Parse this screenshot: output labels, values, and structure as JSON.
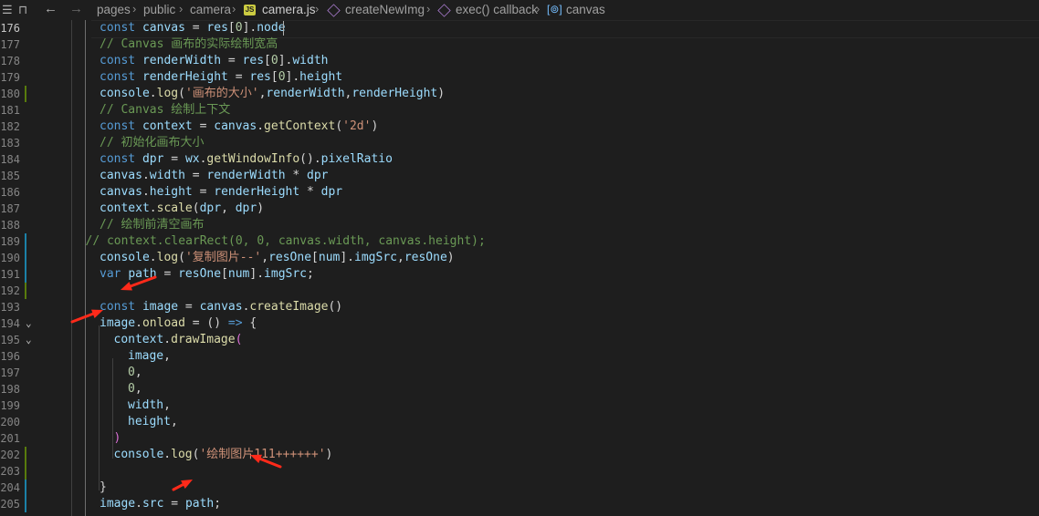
{
  "breadcrumb": {
    "items": [
      "pages",
      "public",
      "camera",
      "camera.js",
      "createNewImg",
      "exec() callback",
      "canvas"
    ],
    "js_badge": "JS"
  },
  "editor": {
    "current_line": 176,
    "lines": [
      {
        "n": "176",
        "tokens": [
          [
            "kw",
            "const "
          ],
          [
            "vr",
            "canvas"
          ],
          [
            "pl",
            " = "
          ],
          [
            "vr",
            "res"
          ],
          [
            "pl",
            "["
          ],
          [
            "num",
            "0"
          ],
          [
            "pl",
            "]."
          ],
          [
            "vr",
            "node"
          ]
        ]
      },
      {
        "n": "177",
        "tokens": [
          [
            "cm",
            "// Canvas 画布的实际绘制宽高"
          ]
        ]
      },
      {
        "n": "178",
        "tokens": [
          [
            "kw",
            "const "
          ],
          [
            "vr",
            "renderWidth"
          ],
          [
            "pl",
            " = "
          ],
          [
            "vr",
            "res"
          ],
          [
            "pl",
            "["
          ],
          [
            "num",
            "0"
          ],
          [
            "pl",
            "]."
          ],
          [
            "vr",
            "width"
          ]
        ]
      },
      {
        "n": "179",
        "tokens": [
          [
            "kw",
            "const "
          ],
          [
            "vr",
            "renderHeight"
          ],
          [
            "pl",
            " = "
          ],
          [
            "vr",
            "res"
          ],
          [
            "pl",
            "["
          ],
          [
            "num",
            "0"
          ],
          [
            "pl",
            "]."
          ],
          [
            "vr",
            "height"
          ]
        ]
      },
      {
        "n": "180",
        "tokens": [
          [
            "vr",
            "console"
          ],
          [
            "pl",
            "."
          ],
          [
            "fn",
            "log"
          ],
          [
            "pl",
            "("
          ],
          [
            "str",
            "'画布的大小'"
          ],
          [
            "pl",
            ","
          ],
          [
            "vr",
            "renderWidth"
          ],
          [
            "pl",
            ","
          ],
          [
            "vr",
            "renderHeight"
          ],
          [
            "pl",
            ")"
          ]
        ]
      },
      {
        "n": "181",
        "tokens": [
          [
            "cm",
            "// Canvas 绘制上下文"
          ]
        ]
      },
      {
        "n": "182",
        "tokens": [
          [
            "kw",
            "const "
          ],
          [
            "vr",
            "context"
          ],
          [
            "pl",
            " = "
          ],
          [
            "vr",
            "canvas"
          ],
          [
            "pl",
            "."
          ],
          [
            "fn",
            "getContext"
          ],
          [
            "pl",
            "("
          ],
          [
            "str",
            "'2d'"
          ],
          [
            "pl",
            ")"
          ]
        ]
      },
      {
        "n": "183",
        "tokens": [
          [
            "cm",
            "// 初始化画布大小"
          ]
        ]
      },
      {
        "n": "184",
        "tokens": [
          [
            "kw",
            "const "
          ],
          [
            "vr",
            "dpr"
          ],
          [
            "pl",
            " = "
          ],
          [
            "vr",
            "wx"
          ],
          [
            "pl",
            "."
          ],
          [
            "fn",
            "getWindowInfo"
          ],
          [
            "pl",
            "()."
          ],
          [
            "vr",
            "pixelRatio"
          ]
        ]
      },
      {
        "n": "185",
        "tokens": [
          [
            "vr",
            "canvas"
          ],
          [
            "pl",
            "."
          ],
          [
            "vr",
            "width"
          ],
          [
            "pl",
            " = "
          ],
          [
            "vr",
            "renderWidth"
          ],
          [
            "pl",
            " * "
          ],
          [
            "vr",
            "dpr"
          ]
        ]
      },
      {
        "n": "186",
        "tokens": [
          [
            "vr",
            "canvas"
          ],
          [
            "pl",
            "."
          ],
          [
            "vr",
            "height"
          ],
          [
            "pl",
            " = "
          ],
          [
            "vr",
            "renderHeight"
          ],
          [
            "pl",
            " * "
          ],
          [
            "vr",
            "dpr"
          ]
        ]
      },
      {
        "n": "187",
        "tokens": [
          [
            "vr",
            "context"
          ],
          [
            "pl",
            "."
          ],
          [
            "fn",
            "scale"
          ],
          [
            "pl",
            "("
          ],
          [
            "vr",
            "dpr"
          ],
          [
            "pl",
            ", "
          ],
          [
            "vr",
            "dpr"
          ],
          [
            "pl",
            ")"
          ]
        ]
      },
      {
        "n": "188",
        "tokens": [
          [
            "cm",
            "// 绘制前清空画布"
          ]
        ]
      },
      {
        "n": "189",
        "indent": -1,
        "tokens": [
          [
            "cm",
            "// context.clearRect(0, 0, canvas.width, canvas.height);"
          ]
        ]
      },
      {
        "n": "190",
        "tokens": [
          [
            "vr",
            "console"
          ],
          [
            "pl",
            "."
          ],
          [
            "fn",
            "log"
          ],
          [
            "pl",
            "("
          ],
          [
            "str",
            "'复制图片--'"
          ],
          [
            "pl",
            ","
          ],
          [
            "vr",
            "resOne"
          ],
          [
            "pl",
            "["
          ],
          [
            "vr",
            "num"
          ],
          [
            "pl",
            "]."
          ],
          [
            "vr",
            "imgSrc"
          ],
          [
            "pl",
            ","
          ],
          [
            "vr",
            "resOne"
          ],
          [
            "pl",
            ")"
          ]
        ]
      },
      {
        "n": "191",
        "tokens": [
          [
            "kw",
            "var "
          ],
          [
            "vr",
            "path"
          ],
          [
            "pl",
            " = "
          ],
          [
            "vr",
            "resOne"
          ],
          [
            "pl",
            "["
          ],
          [
            "vr",
            "num"
          ],
          [
            "pl",
            "]."
          ],
          [
            "vr",
            "imgSrc"
          ],
          [
            "pl",
            ";"
          ]
        ]
      },
      {
        "n": "192",
        "tokens": []
      },
      {
        "n": "193",
        "tokens": [
          [
            "kw",
            "const "
          ],
          [
            "vr",
            "image"
          ],
          [
            "pl",
            " = "
          ],
          [
            "vr",
            "canvas"
          ],
          [
            "pl",
            "."
          ],
          [
            "fn",
            "createImage"
          ],
          [
            "pl",
            "()"
          ]
        ]
      },
      {
        "n": "194",
        "tokens": [
          [
            "vr",
            "image"
          ],
          [
            "pl",
            "."
          ],
          [
            "fn",
            "onload"
          ],
          [
            "pl",
            " = () "
          ],
          [
            "kw",
            "=>"
          ],
          [
            "pl",
            " {"
          ]
        ]
      },
      {
        "n": "195",
        "indent": 1,
        "tokens": [
          [
            "vr",
            "context"
          ],
          [
            "pl",
            "."
          ],
          [
            "fn",
            "drawImage"
          ],
          [
            "br2",
            "("
          ]
        ]
      },
      {
        "n": "196",
        "indent": 2,
        "tokens": [
          [
            "vr",
            "image"
          ],
          [
            "pl",
            ","
          ]
        ]
      },
      {
        "n": "197",
        "indent": 2,
        "tokens": [
          [
            "num",
            "0"
          ],
          [
            "pl",
            ","
          ]
        ]
      },
      {
        "n": "198",
        "indent": 2,
        "tokens": [
          [
            "num",
            "0"
          ],
          [
            "pl",
            ","
          ]
        ]
      },
      {
        "n": "199",
        "indent": 2,
        "tokens": [
          [
            "vr",
            "width"
          ],
          [
            "pl",
            ","
          ]
        ]
      },
      {
        "n": "200",
        "indent": 2,
        "tokens": [
          [
            "vr",
            "height"
          ],
          [
            "pl",
            ","
          ]
        ]
      },
      {
        "n": "201",
        "indent": 1,
        "tokens": [
          [
            "br2",
            ")"
          ]
        ]
      },
      {
        "n": "202",
        "indent": 1,
        "tokens": [
          [
            "vr",
            "console"
          ],
          [
            "pl",
            "."
          ],
          [
            "fn",
            "log"
          ],
          [
            "pl",
            "("
          ],
          [
            "str",
            "'绘制图片111++++++'"
          ],
          [
            "pl",
            ")"
          ]
        ]
      },
      {
        "n": "203",
        "tokens": []
      },
      {
        "n": "204",
        "tokens": [
          [
            "pl",
            "}"
          ]
        ]
      },
      {
        "n": "205",
        "tokens": [
          [
            "vr",
            "image"
          ],
          [
            "pl",
            "."
          ],
          [
            "vr",
            "src"
          ],
          [
            "pl",
            " = "
          ],
          [
            "vr",
            "path"
          ],
          [
            "pl",
            ";"
          ]
        ]
      }
    ]
  },
  "annotations": {
    "arrow_color": "#ff2a1a"
  }
}
